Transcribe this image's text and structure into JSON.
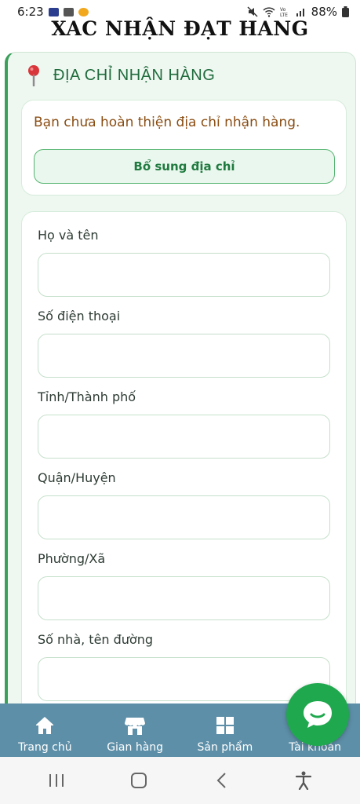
{
  "status_bar": {
    "time": "6:23",
    "battery": "88%"
  },
  "page": {
    "title": "XAC NHẬN ĐẠT HANG"
  },
  "address_section": {
    "title": "ĐỊA CHỈ NHẬN HÀNG",
    "notice": "Bạn chưa hoàn thiện địa chỉ nhận hàng.",
    "add_button": "Bổ sung địa chỉ"
  },
  "form": {
    "fields": [
      {
        "label": "Họ và tên",
        "value": ""
      },
      {
        "label": "Số điện thoại",
        "value": ""
      },
      {
        "label": "Tỉnh/Thành phố",
        "value": ""
      },
      {
        "label": "Quận/Huyện",
        "value": ""
      },
      {
        "label": "Phường/Xã",
        "value": ""
      },
      {
        "label": "Số nhà, tên đường",
        "value": ""
      }
    ]
  },
  "bottom_nav": {
    "items": [
      {
        "label": "Trang chủ",
        "icon": "home-icon"
      },
      {
        "label": "Gian hàng",
        "icon": "store-icon"
      },
      {
        "label": "Sản phẩm",
        "icon": "grid-icon"
      },
      {
        "label": "Tài khoản",
        "icon": "account-icon"
      }
    ]
  },
  "colors": {
    "accent": "#3aa05a",
    "nav_bg": "#5d8fa8",
    "notice": "#8a4d12",
    "fab": "#1fa84e"
  }
}
